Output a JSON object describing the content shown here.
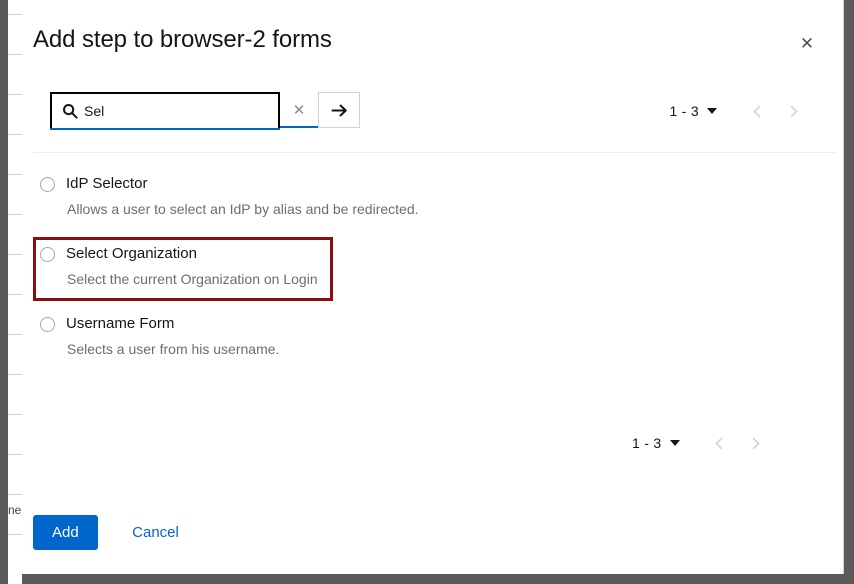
{
  "background": {
    "snippet_text": "ne",
    "row_line_count": 14,
    "row_line_spacing": 40
  },
  "modal": {
    "title": "Add step to browser-2 forms",
    "close_icon": "close-icon",
    "close_label": "✕"
  },
  "search": {
    "icon": "search-icon",
    "value": "Sel",
    "placeholder": "",
    "clear_label": "✕",
    "clear_icon": "clear-icon",
    "submit_icon": "arrow-right-icon"
  },
  "pagination_top": {
    "range": "1 - 3",
    "caret_icon": "chevron-down-icon",
    "prev_icon": "chevron-left-icon",
    "next_icon": "chevron-right-icon"
  },
  "pagination_bottom": {
    "range": "1 - 3",
    "caret_icon": "chevron-down-icon",
    "prev_icon": "chevron-left-icon",
    "next_icon": "chevron-right-icon"
  },
  "options": [
    {
      "label": "IdP Selector",
      "description": "Allows a user to select an IdP by alias and be redirected.",
      "selected": false
    },
    {
      "label": "Select Organization",
      "description": "Select the current Organization on Login",
      "selected": false,
      "highlighted": true
    },
    {
      "label": "Username Form",
      "description": "Selects a user from his username.",
      "selected": false
    }
  ],
  "footer": {
    "add_label": "Add",
    "cancel_label": "Cancel"
  },
  "colors": {
    "primary": "#0066cc",
    "annotation": "#8b0f0f",
    "text": "#151515",
    "muted": "#6a6e73",
    "backdrop": "#5b5b5b"
  }
}
